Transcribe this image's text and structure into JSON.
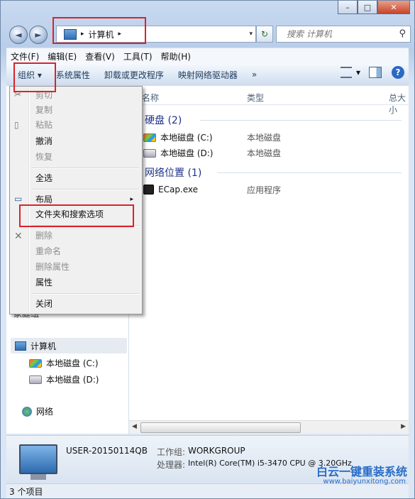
{
  "window": {
    "caption_min": "–",
    "caption_max": "□",
    "caption_close": "✕"
  },
  "nav": {
    "back_icon": "◄",
    "forward_icon": "►",
    "address_arrow1": "▸",
    "address_text": "计算机",
    "address_arrow2": "▸",
    "dropdown_arrow": "▾",
    "refresh_icon": "↻",
    "search_placeholder": "搜索 计算机",
    "search_icon": "⚲"
  },
  "menubar": [
    "文件(F)",
    "编辑(E)",
    "查看(V)",
    "工具(T)",
    "帮助(H)"
  ],
  "toolbar": {
    "organize": "组织 ▾",
    "items": [
      "系统属性",
      "卸载或更改程序",
      "映射网络驱动器",
      "»"
    ],
    "view_dropdown": "▾",
    "help": "?"
  },
  "organize_menu": {
    "items": [
      "剪切",
      "复制",
      "粘贴",
      "撤消",
      "恢复",
      "全选",
      "布局",
      "文件夹和搜索选项",
      "删除",
      "重命名",
      "删除属性",
      "属性",
      "关闭"
    ],
    "submenu_arrow": "▸"
  },
  "content": {
    "columns": [
      "名称",
      "类型",
      "总大小"
    ],
    "groups": [
      {
        "title": "硬盘 (2)",
        "items": [
          {
            "name": "本地磁盘 (C:)",
            "type": "本地磁盘"
          },
          {
            "name": "本地磁盘 (D:)",
            "type": "本地磁盘"
          }
        ]
      },
      {
        "title": "网络位置 (1)",
        "items": [
          {
            "name": "ECap.exe",
            "type": "应用程序"
          }
        ]
      }
    ]
  },
  "navpane": {
    "homegroup_partial": "家庭组",
    "computer": "计算机",
    "drive_c": "本地磁盘 (C:)",
    "drive_d": "本地磁盘 (D:)",
    "network": "网络"
  },
  "details": {
    "name": "USER-20150114QB",
    "workgroup_label": "工作组:",
    "workgroup": "WORKGROUP",
    "cpu_label": "处理器:",
    "cpu": "Intel(R) Core(TM) i5-3470 CPU @ 3.20GHz"
  },
  "status": {
    "count": "3 个项目"
  },
  "watermark": {
    "text": "白云一键重装系统",
    "url": "www.baiyunxitong.com"
  },
  "colors": {
    "highlight_red": "#d9232b",
    "group_blue": "#1e3287"
  }
}
